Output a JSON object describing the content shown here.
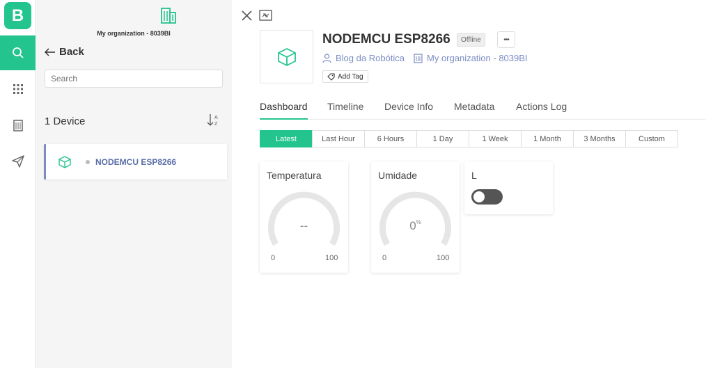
{
  "rail": {
    "logo_letter": "B",
    "icons": [
      "search-icon",
      "grid-icon",
      "building-icon",
      "send-icon"
    ],
    "accent": "#23c48e"
  },
  "panel": {
    "org_name": "My organization - 8039BI",
    "back_label": "Back",
    "search_placeholder": "Search",
    "device_count": "1 Device",
    "devices": [
      {
        "name": "NODEMCU ESP8266"
      }
    ]
  },
  "device": {
    "title": "NODEMCU ESP8266",
    "status": "Offline",
    "owner": "Blog da Robótica",
    "organization": "My organization - 8039BI",
    "add_tag_label": "Add Tag",
    "more_label": "•••"
  },
  "tabs": [
    "Dashboard",
    "Timeline",
    "Device Info",
    "Metadata",
    "Actions Log"
  ],
  "active_tab": "Dashboard",
  "ranges": [
    "Latest",
    "Last Hour",
    "6 Hours",
    "1 Day",
    "1 Week",
    "1 Month",
    "3 Months",
    "Custom"
  ],
  "active_range": "Latest",
  "widgets": {
    "temperatura": {
      "title": "Temperatura",
      "value": "--",
      "min": "0",
      "max": "100"
    },
    "umidade": {
      "title": "Umidade",
      "value": "0",
      "unit": "%",
      "min": "0",
      "max": "100"
    },
    "switch_l": {
      "title": "L",
      "state": "off"
    }
  }
}
